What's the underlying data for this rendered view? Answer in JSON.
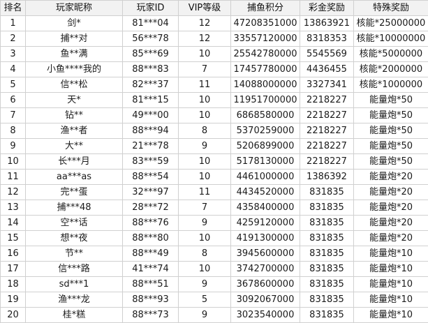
{
  "columns": [
    "排名",
    "玩家昵称",
    "玩家ID",
    "VIP等级",
    "捕鱼积分",
    "彩金奖励",
    "特殊奖励"
  ],
  "rows": [
    [
      "1",
      "剑*",
      "81***04",
      "12",
      "47208351000",
      "13863921",
      "核能*25000000"
    ],
    [
      "2",
      "捕**对",
      "56***78",
      "12",
      "33557120000",
      "8318353",
      "核能*10000000"
    ],
    [
      "3",
      "鱼**满",
      "85***69",
      "10",
      "25542780000",
      "5545569",
      "核能*5000000"
    ],
    [
      "4",
      "小鱼****我的",
      "88***83",
      "7",
      "17457780000",
      "4436455",
      "核能*2000000"
    ],
    [
      "5",
      "信**松",
      "82***37",
      "11",
      "14088000000",
      "3327341",
      "核能*1000000"
    ],
    [
      "6",
      "天*",
      "81***15",
      "10",
      "11951700000",
      "2218227",
      "能量炮*50"
    ],
    [
      "7",
      "钻**",
      "49***00",
      "10",
      "6868580000",
      "2218227",
      "能量炮*50"
    ],
    [
      "8",
      "渔**者",
      "88***94",
      "8",
      "5370259000",
      "2218227",
      "能量炮*50"
    ],
    [
      "9",
      "大**",
      "21***78",
      "9",
      "5206899000",
      "2218227",
      "能量炮*50"
    ],
    [
      "10",
      "长***月",
      "83***59",
      "10",
      "5178130000",
      "2218227",
      "能量炮*50"
    ],
    [
      "11",
      "aa***as",
      "88***54",
      "10",
      "4461000000",
      "1386392",
      "能量炮*20"
    ],
    [
      "12",
      "完**蛋",
      "32***97",
      "11",
      "4434520000",
      "831835",
      "能量炮*20"
    ],
    [
      "13",
      "捕***48",
      "28***72",
      "7",
      "4358400000",
      "831835",
      "能量炮*20"
    ],
    [
      "14",
      "空**话",
      "88***76",
      "9",
      "4259120000",
      "831835",
      "能量炮*20"
    ],
    [
      "15",
      "想**夜",
      "88***80",
      "10",
      "4191300000",
      "831835",
      "能量炮*20"
    ],
    [
      "16",
      "节**",
      "88***49",
      "8",
      "3945600000",
      "831835",
      "能量炮*10"
    ],
    [
      "17",
      "信***路",
      "41***74",
      "10",
      "3742700000",
      "831835",
      "能量炮*10"
    ],
    [
      "18",
      "sd***1",
      "88***51",
      "9",
      "3678600000",
      "831835",
      "能量炮*10"
    ],
    [
      "19",
      "渔***龙",
      "88***93",
      "5",
      "3092067000",
      "831835",
      "能量炮*10"
    ],
    [
      "20",
      "桂*糕",
      "88***73",
      "9",
      "3023540000",
      "831835",
      "能量炮*10"
    ]
  ]
}
